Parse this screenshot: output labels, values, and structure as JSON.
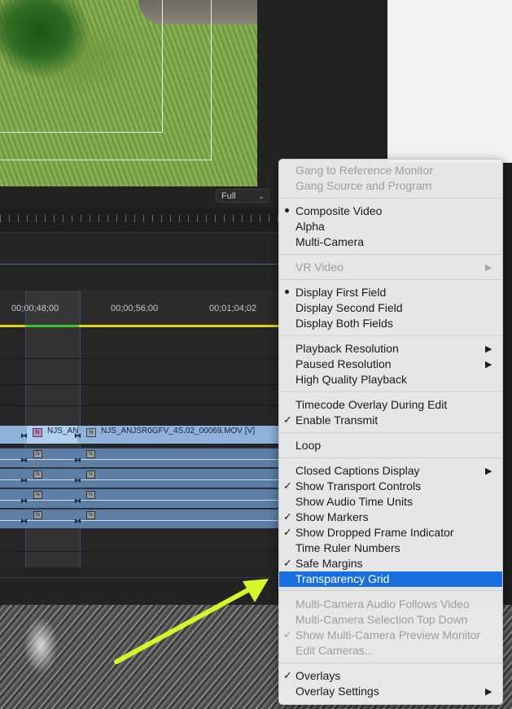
{
  "monitor": {
    "resolution": "Full"
  },
  "timeline": {
    "timecodes": [
      "00;00;48;00",
      "00;00;56;00",
      "00;01;04;02"
    ],
    "video_clip_short": "NJS_AN",
    "video_clip_name": "NJS_ANJSR0GFV_4S.02_00069.MOV [V]",
    "fx_label": "fx"
  },
  "menu": {
    "gang_ref": "Gang to Reference Monitor",
    "gang_src": "Gang Source and Program",
    "composite_video": "Composite Video",
    "alpha": "Alpha",
    "multi_camera": "Multi-Camera",
    "vr_video": "VR Video",
    "display_first": "Display First Field",
    "display_second": "Display Second Field",
    "display_both": "Display Both Fields",
    "playback_res": "Playback Resolution",
    "paused_res": "Paused Resolution",
    "hq_playback": "High Quality Playback",
    "timecode_overlay": "Timecode Overlay During Edit",
    "enable_transmit": "Enable Transmit",
    "loop": "Loop",
    "closed_captions": "Closed Captions Display",
    "show_transport": "Show Transport Controls",
    "show_audio_time": "Show Audio Time Units",
    "show_markers": "Show Markers",
    "show_dropped": "Show Dropped Frame Indicator",
    "time_ruler": "Time Ruler Numbers",
    "safe_margins": "Safe Margins",
    "transparency_grid": "Transparency Grid",
    "mc_audio": "Multi-Camera Audio Follows Video",
    "mc_selection": "Multi-Camera Selection Top Down",
    "mc_preview": "Show Multi-Camera Preview Monitor",
    "edit_cameras": "Edit Cameras...",
    "overlays": "Overlays",
    "overlay_settings": "Overlay Settings",
    "check_glyph": "✓",
    "submenu_glyph": "▶"
  },
  "colors": {
    "highlight": "#1a6fde",
    "arrow": "#d8f52a"
  }
}
